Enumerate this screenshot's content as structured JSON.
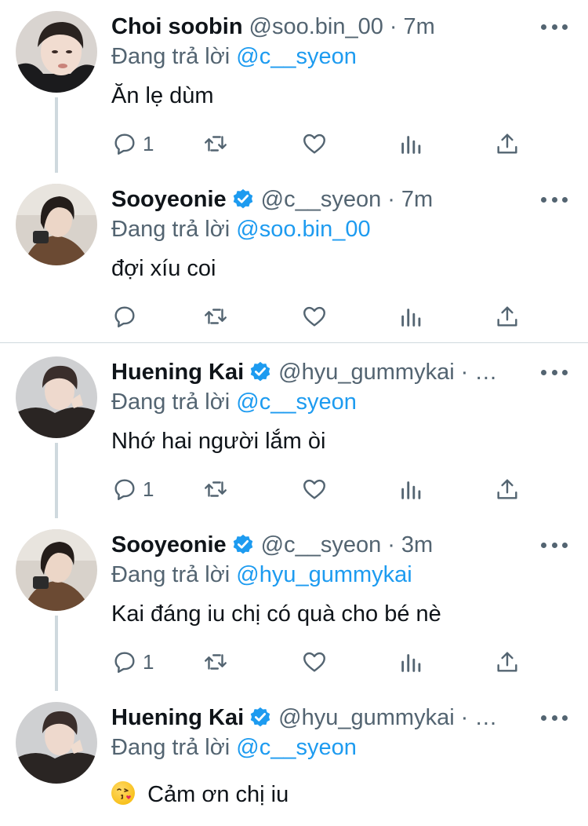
{
  "colors": {
    "accent": "#1d9bf0",
    "muted": "#536471",
    "text": "#0f1419",
    "line": "#cfd9de"
  },
  "reply_prefix": "Đang trả lời",
  "tweets": [
    {
      "name": "Choi soobin",
      "verified": false,
      "handle": "@soo.bin_00",
      "time": "7m",
      "reply_to": "@c__syeon",
      "text": "Ăn lẹ dùm",
      "reply_count": "1"
    },
    {
      "name": "Sooyeonie",
      "verified": true,
      "handle": "@c__syeon",
      "time": "7m",
      "reply_to": "@soo.bin_00",
      "text": "đợi xíu coi",
      "reply_count": ""
    },
    {
      "name": "Huening Kai",
      "verified": true,
      "handle": "@hyu_gummykai",
      "time": "…",
      "reply_to": "@c__syeon",
      "text": "Nhớ hai người lắm òi",
      "reply_count": "1"
    },
    {
      "name": "Sooyeonie",
      "verified": true,
      "handle": "@c__syeon",
      "time": "3m",
      "reply_to": "@hyu_gummykai",
      "text": "Kai đáng iu chị có quà cho bé nè",
      "reply_count": "1"
    },
    {
      "name": "Huening Kai",
      "verified": true,
      "handle": "@hyu_gummykai",
      "time": "…",
      "reply_to": "@c__syeon",
      "emoji": "face-blowing-kiss",
      "text": "Cảm ơn chị iu",
      "reply_count": ""
    }
  ]
}
